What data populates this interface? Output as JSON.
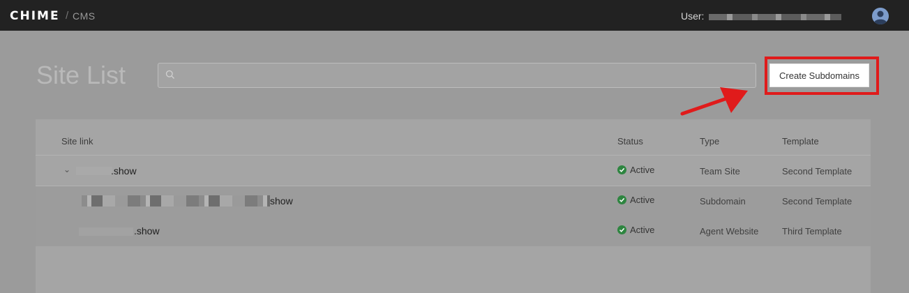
{
  "header": {
    "brand": "CHIME",
    "separator": "/",
    "product": "CMS",
    "user_label": "User:"
  },
  "main": {
    "title": "Site List",
    "search_placeholder": "",
    "create_button_label": "Create Subdomains"
  },
  "table": {
    "columns": [
      "Site link",
      "Status",
      "Type",
      "Template"
    ],
    "rows": [
      {
        "link": ".show",
        "status": "Active",
        "type": "Team Site",
        "template": "Second Template"
      },
      {
        "link": "show",
        "status": "Active",
        "type": "Subdomain",
        "template": "Second Template"
      },
      {
        "link": ".show",
        "status": "Active",
        "type": "Agent Website",
        "template": "Third Template"
      }
    ]
  },
  "colors": {
    "topbar": "#222222",
    "highlight": "#e01b1b",
    "status_active": "#2e8540"
  },
  "icons": [
    "search-icon",
    "user-avatar-icon",
    "chevron-down-icon",
    "check-circle-icon",
    "arrow-annotation-icon"
  ]
}
